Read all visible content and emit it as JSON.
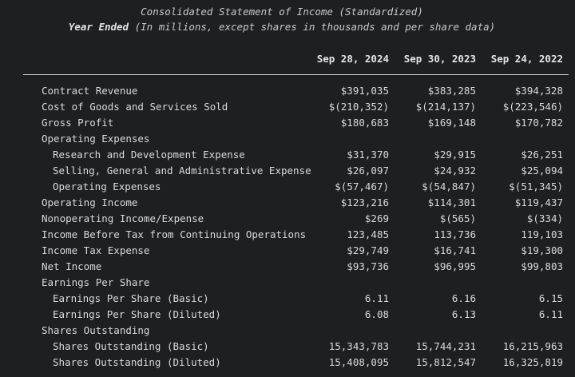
{
  "header": {
    "title": "Consolidated Statement of Income (Standardized)",
    "subtitle_bold": "Year Ended",
    "subtitle_rest": " (In millions, except shares in thousands and per share data)"
  },
  "columns": [
    "Sep 28, 2024",
    "Sep 30, 2023",
    "Sep 24, 2022"
  ],
  "rows": [
    {
      "label": "Contract Revenue",
      "indent": false,
      "values": [
        "$391,035",
        "$383,285",
        "$394,328"
      ]
    },
    {
      "label": "Cost of Goods and Services Sold",
      "indent": false,
      "values": [
        "$(210,352)",
        "$(214,137)",
        "$(223,546)"
      ]
    },
    {
      "label": "Gross Profit",
      "indent": false,
      "values": [
        "$180,683",
        "$169,148",
        "$170,782"
      ]
    },
    {
      "label": "Operating Expenses",
      "indent": false,
      "values": [
        "",
        "",
        ""
      ]
    },
    {
      "label": "Research and Development Expense",
      "indent": true,
      "values": [
        "$31,370",
        "$29,915",
        "$26,251"
      ]
    },
    {
      "label": "Selling, General and Administrative Expense",
      "indent": true,
      "values": [
        "$26,097",
        "$24,932",
        "$25,094"
      ]
    },
    {
      "label": "Operating Expenses",
      "indent": true,
      "values": [
        "$(57,467)",
        "$(54,847)",
        "$(51,345)"
      ]
    },
    {
      "label": "Operating Income",
      "indent": false,
      "values": [
        "$123,216",
        "$114,301",
        "$119,437"
      ]
    },
    {
      "label": "Nonoperating Income/Expense",
      "indent": false,
      "values": [
        "$269",
        "$(565)",
        "$(334)"
      ]
    },
    {
      "label": "Income Before Tax from Continuing Operations",
      "indent": false,
      "values": [
        "123,485",
        "113,736",
        "119,103"
      ]
    },
    {
      "label": "Income Tax Expense",
      "indent": false,
      "values": [
        "$29,749",
        "$16,741",
        "$19,300"
      ]
    },
    {
      "label": "Net Income",
      "indent": false,
      "values": [
        "$93,736",
        "$96,995",
        "$99,803"
      ]
    },
    {
      "label": "Earnings Per Share",
      "indent": false,
      "values": [
        "",
        "",
        ""
      ]
    },
    {
      "label": "Earnings Per Share (Basic)",
      "indent": true,
      "values": [
        "6.11",
        "6.16",
        "6.15"
      ]
    },
    {
      "label": "Earnings Per Share (Diluted)",
      "indent": true,
      "values": [
        "6.08",
        "6.13",
        "6.11"
      ]
    },
    {
      "label": "Shares Outstanding",
      "indent": false,
      "values": [
        "",
        "",
        ""
      ]
    },
    {
      "label": "Shares Outstanding (Basic)",
      "indent": true,
      "values": [
        "15,343,783",
        "15,744,231",
        "16,215,963"
      ]
    },
    {
      "label": "Shares Outstanding (Diluted)",
      "indent": true,
      "values": [
        "15,408,095",
        "15,812,547",
        "16,325,819"
      ]
    }
  ]
}
